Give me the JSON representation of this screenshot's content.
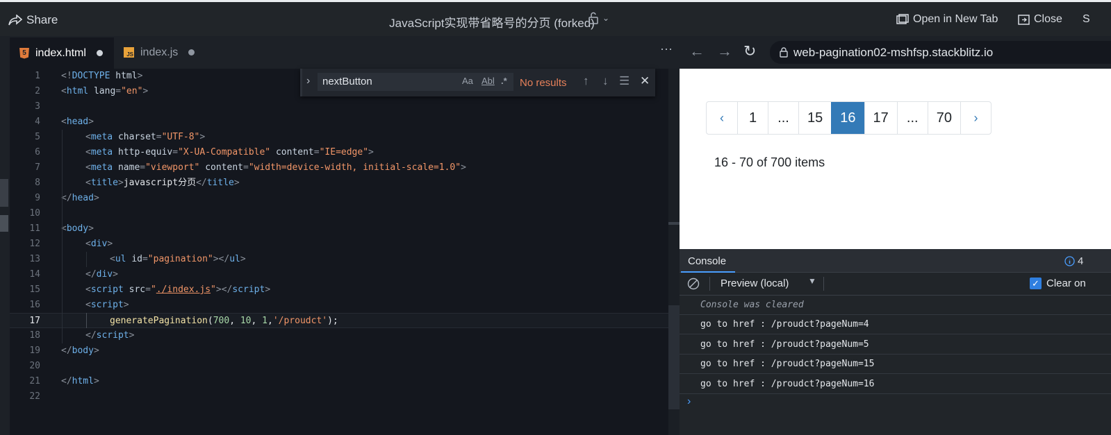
{
  "topbar": {
    "share_label": "Share",
    "title": "JavaScript实现带省略号的分页 (forked)",
    "open_new_tab": "Open in New Tab",
    "close": "Close",
    "cut_label": "S"
  },
  "tabs": [
    {
      "label": "index.html",
      "icon": "html5-icon",
      "modified": true
    },
    {
      "label": "index.js",
      "icon": "js-icon",
      "modified": true
    }
  ],
  "find": {
    "value": "nextButton",
    "match_case": "Aa",
    "whole_word": "Abl",
    "regex": ".*",
    "status": "No results"
  },
  "browser": {
    "url": "web-pagination02-mshfsp.stackblitz.io"
  },
  "code": {
    "current_line": 17,
    "line_numbers": [
      "1",
      "2",
      "3",
      "4",
      "5",
      "6",
      "7",
      "8",
      "9",
      "10",
      "11",
      "12",
      "13",
      "14",
      "15",
      "16",
      "17",
      "18",
      "19",
      "20",
      "21",
      "22"
    ],
    "lines": [
      {
        "indent": 0,
        "segs": [
          [
            "p",
            "<!"
          ],
          [
            "t",
            "DOCTYPE "
          ],
          [
            "a",
            "html"
          ],
          [
            "p",
            ">"
          ]
        ]
      },
      {
        "indent": 0,
        "segs": [
          [
            "p",
            "<"
          ],
          [
            "t",
            "html "
          ],
          [
            "a",
            "lang"
          ],
          [
            "p",
            "="
          ],
          [
            "s",
            "\"en\""
          ],
          [
            "p",
            ">"
          ]
        ]
      },
      {
        "indent": 0,
        "segs": []
      },
      {
        "indent": 0,
        "segs": [
          [
            "p",
            "<"
          ],
          [
            "t",
            "head"
          ],
          [
            "p",
            ">"
          ]
        ]
      },
      {
        "indent": 1,
        "segs": [
          [
            "p",
            "<"
          ],
          [
            "t",
            "meta "
          ],
          [
            "a",
            "charset"
          ],
          [
            "p",
            "="
          ],
          [
            "s",
            "\"UTF-8\""
          ],
          [
            "p",
            ">"
          ]
        ]
      },
      {
        "indent": 1,
        "segs": [
          [
            "p",
            "<"
          ],
          [
            "t",
            "meta "
          ],
          [
            "a",
            "http-equiv"
          ],
          [
            "p",
            "="
          ],
          [
            "s",
            "\"X-UA-Compatible\" "
          ],
          [
            "a",
            "content"
          ],
          [
            "p",
            "="
          ],
          [
            "s",
            "\"IE=edge\""
          ],
          [
            "p",
            ">"
          ]
        ]
      },
      {
        "indent": 1,
        "segs": [
          [
            "p",
            "<"
          ],
          [
            "t",
            "meta "
          ],
          [
            "a",
            "name"
          ],
          [
            "p",
            "="
          ],
          [
            "s",
            "\"viewport\" "
          ],
          [
            "a",
            "content"
          ],
          [
            "p",
            "="
          ],
          [
            "s",
            "\"width=device-width, initial-scale=1.0\""
          ],
          [
            "p",
            ">"
          ]
        ]
      },
      {
        "indent": 1,
        "segs": [
          [
            "p",
            "<"
          ],
          [
            "t",
            "title"
          ],
          [
            "p",
            ">"
          ],
          [
            "x",
            "javascript分页"
          ],
          [
            "p",
            "</"
          ],
          [
            "t",
            "title"
          ],
          [
            "p",
            ">"
          ]
        ]
      },
      {
        "indent": 0,
        "segs": [
          [
            "p",
            "</"
          ],
          [
            "t",
            "head"
          ],
          [
            "p",
            ">"
          ]
        ]
      },
      {
        "indent": 0,
        "segs": []
      },
      {
        "indent": 0,
        "segs": [
          [
            "p",
            "<"
          ],
          [
            "t",
            "body"
          ],
          [
            "p",
            ">"
          ]
        ]
      },
      {
        "indent": 1,
        "segs": [
          [
            "p",
            "<"
          ],
          [
            "t",
            "div"
          ],
          [
            "p",
            ">"
          ]
        ]
      },
      {
        "indent": 2,
        "segs": [
          [
            "p",
            "<"
          ],
          [
            "t",
            "ul "
          ],
          [
            "a",
            "id"
          ],
          [
            "p",
            "="
          ],
          [
            "s",
            "\"pagination\""
          ],
          [
            "p",
            "></"
          ],
          [
            "t",
            "ul"
          ],
          [
            "p",
            ">"
          ]
        ]
      },
      {
        "indent": 1,
        "segs": [
          [
            "p",
            "</"
          ],
          [
            "t",
            "div"
          ],
          [
            "p",
            ">"
          ]
        ]
      },
      {
        "indent": 1,
        "segs": [
          [
            "p",
            "<"
          ],
          [
            "t",
            "script "
          ],
          [
            "a",
            "src"
          ],
          [
            "p",
            "="
          ],
          [
            "s",
            "\""
          ],
          [
            "u",
            "./index.js"
          ],
          [
            "s",
            "\""
          ],
          [
            "p",
            "></"
          ],
          [
            "t",
            "script"
          ],
          [
            "p",
            ">"
          ]
        ]
      },
      {
        "indent": 1,
        "segs": [
          [
            "p",
            "<"
          ],
          [
            "t",
            "script"
          ],
          [
            "p",
            ">"
          ]
        ]
      },
      {
        "indent": 2,
        "segs": [
          [
            "fn",
            "generatePagination"
          ],
          [
            "x",
            "("
          ],
          [
            "n",
            "700"
          ],
          [
            "x",
            ", "
          ],
          [
            "n",
            "10"
          ],
          [
            "x",
            ", "
          ],
          [
            "n",
            "1"
          ],
          [
            "x",
            ","
          ],
          [
            "s",
            "'/proudct'"
          ],
          [
            "x",
            ");"
          ]
        ]
      },
      {
        "indent": 1,
        "segs": [
          [
            "p",
            "</"
          ],
          [
            "t",
            "script"
          ],
          [
            "p",
            ">"
          ]
        ]
      },
      {
        "indent": 0,
        "segs": [
          [
            "p",
            "</"
          ],
          [
            "t",
            "body"
          ],
          [
            "p",
            ">"
          ]
        ]
      },
      {
        "indent": 0,
        "segs": []
      },
      {
        "indent": 0,
        "segs": [
          [
            "p",
            "</"
          ],
          [
            "t",
            "html"
          ],
          [
            "p",
            ">"
          ]
        ]
      },
      {
        "indent": 0,
        "segs": []
      }
    ]
  },
  "preview": {
    "pagination": [
      {
        "label": "‹",
        "kind": "arrow"
      },
      {
        "label": "1",
        "kind": "page"
      },
      {
        "label": "...",
        "kind": "ellipsis"
      },
      {
        "label": "15",
        "kind": "page"
      },
      {
        "label": "16",
        "kind": "active"
      },
      {
        "label": "17",
        "kind": "page"
      },
      {
        "label": "...",
        "kind": "ellipsis"
      },
      {
        "label": "70",
        "kind": "page"
      },
      {
        "label": "›",
        "kind": "arrow"
      }
    ],
    "items_text": "16 - 70 of 700 items"
  },
  "console": {
    "tab_label": "Console",
    "count": "4",
    "context": "Preview (local)",
    "clear_on_label": "Clear on",
    "cleared_message": "Console was cleared",
    "logs": [
      "go to href : /proudct?pageNum=4",
      "go to href : /proudct?pageNum=5",
      "go to href : /proudct?pageNum=15",
      "go to href : /proudct?pageNum=16"
    ],
    "prompt": "›"
  },
  "colors": {
    "accent": "#337ab7",
    "error_text": "#e6805a",
    "console_link": "#4a9eff"
  }
}
